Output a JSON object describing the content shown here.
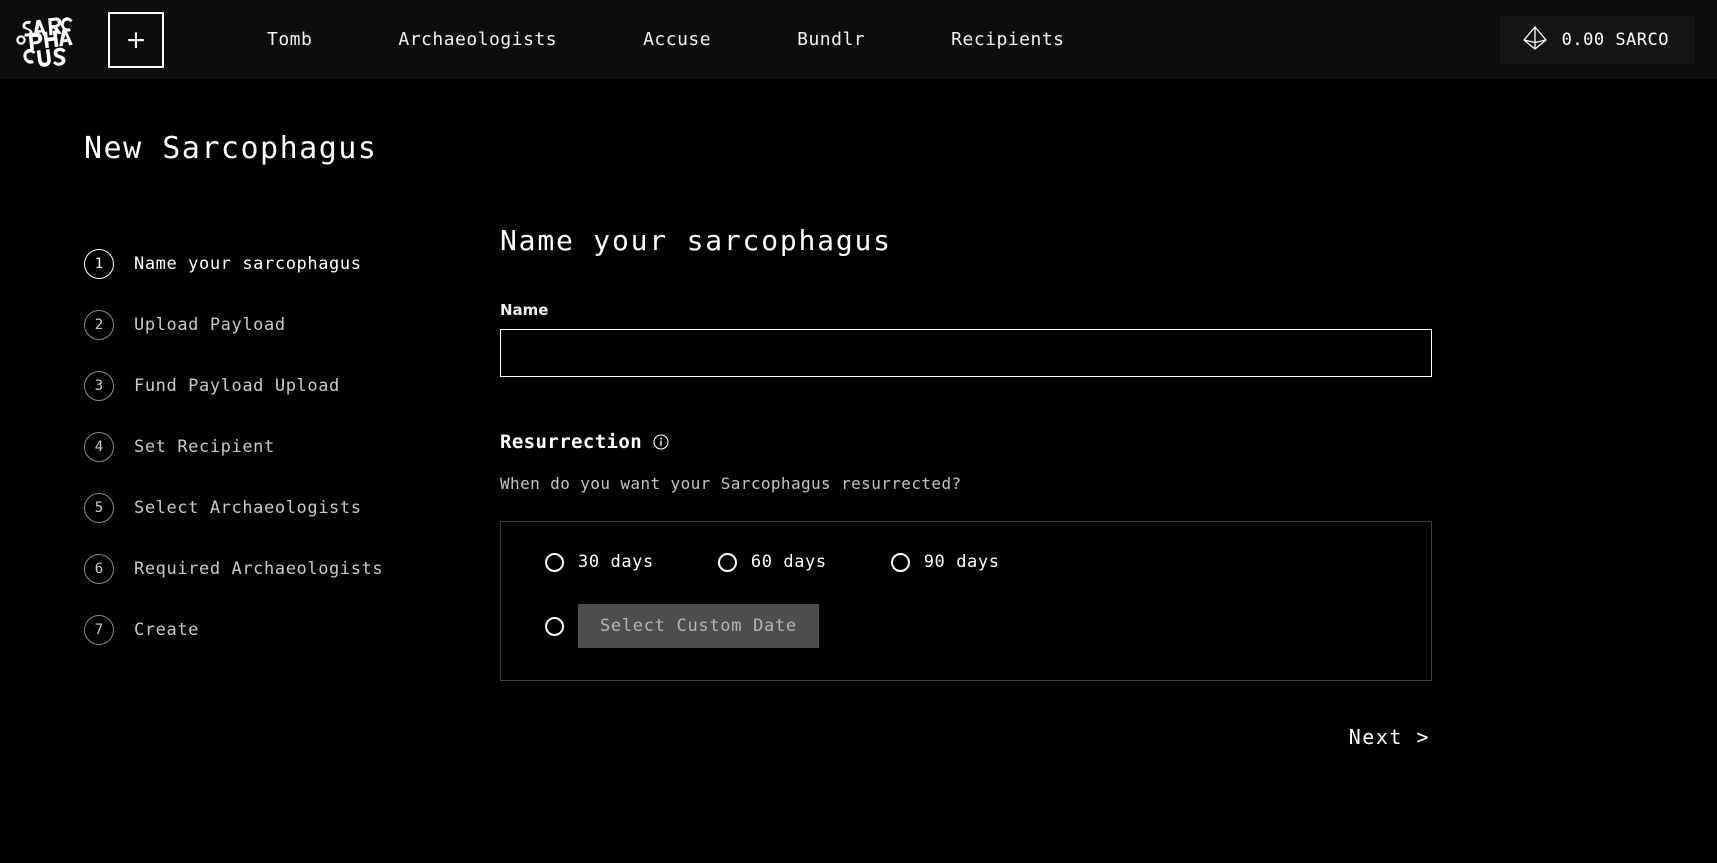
{
  "navbar": {
    "logo_text": "SARCOPHAGUS",
    "logo_icon": "sarcophagus-logo-icon",
    "new_button_label": "+",
    "links": [
      {
        "label": "Tomb"
      },
      {
        "label": "Archaeologists"
      },
      {
        "label": "Accuse"
      },
      {
        "label": "Bundlr"
      },
      {
        "label": "Recipients"
      }
    ],
    "balance": {
      "icon": "sarco-diamond-icon",
      "amount": "0.00 SARCO"
    }
  },
  "page": {
    "title": "New Sarcophagus"
  },
  "steps": [
    {
      "number": "1",
      "label": "Name your sarcophagus",
      "active": true
    },
    {
      "number": "2",
      "label": "Upload Payload",
      "active": false
    },
    {
      "number": "3",
      "label": "Fund Payload Upload",
      "active": false
    },
    {
      "number": "4",
      "label": "Set Recipient",
      "active": false
    },
    {
      "number": "5",
      "label": "Select Archaeologists",
      "active": false
    },
    {
      "number": "6",
      "label": "Required Archaeologists",
      "active": false
    },
    {
      "number": "7",
      "label": "Create",
      "active": false
    }
  ],
  "form": {
    "heading": "Name your sarcophagus",
    "name_field": {
      "label": "Name",
      "value": "",
      "placeholder": ""
    },
    "resurrection": {
      "title": "Resurrection",
      "info_icon": "info-circle-icon",
      "description": "When do you want your Sarcophagus resurrected?",
      "options": [
        {
          "label": "30 days",
          "selected": false
        },
        {
          "label": "60 days",
          "selected": false
        },
        {
          "label": "90 days",
          "selected": false
        }
      ],
      "custom": {
        "label": "Select Custom Date",
        "selected": false,
        "disabled": true
      }
    },
    "next_label": "Next >"
  },
  "colors": {
    "background": "#000000",
    "navbar": "#0d0d0d",
    "accent": "#ffffff",
    "border": "#3c3c3c",
    "muted": "#b4b4b4",
    "disabled_bg": "#4e4e4e"
  }
}
